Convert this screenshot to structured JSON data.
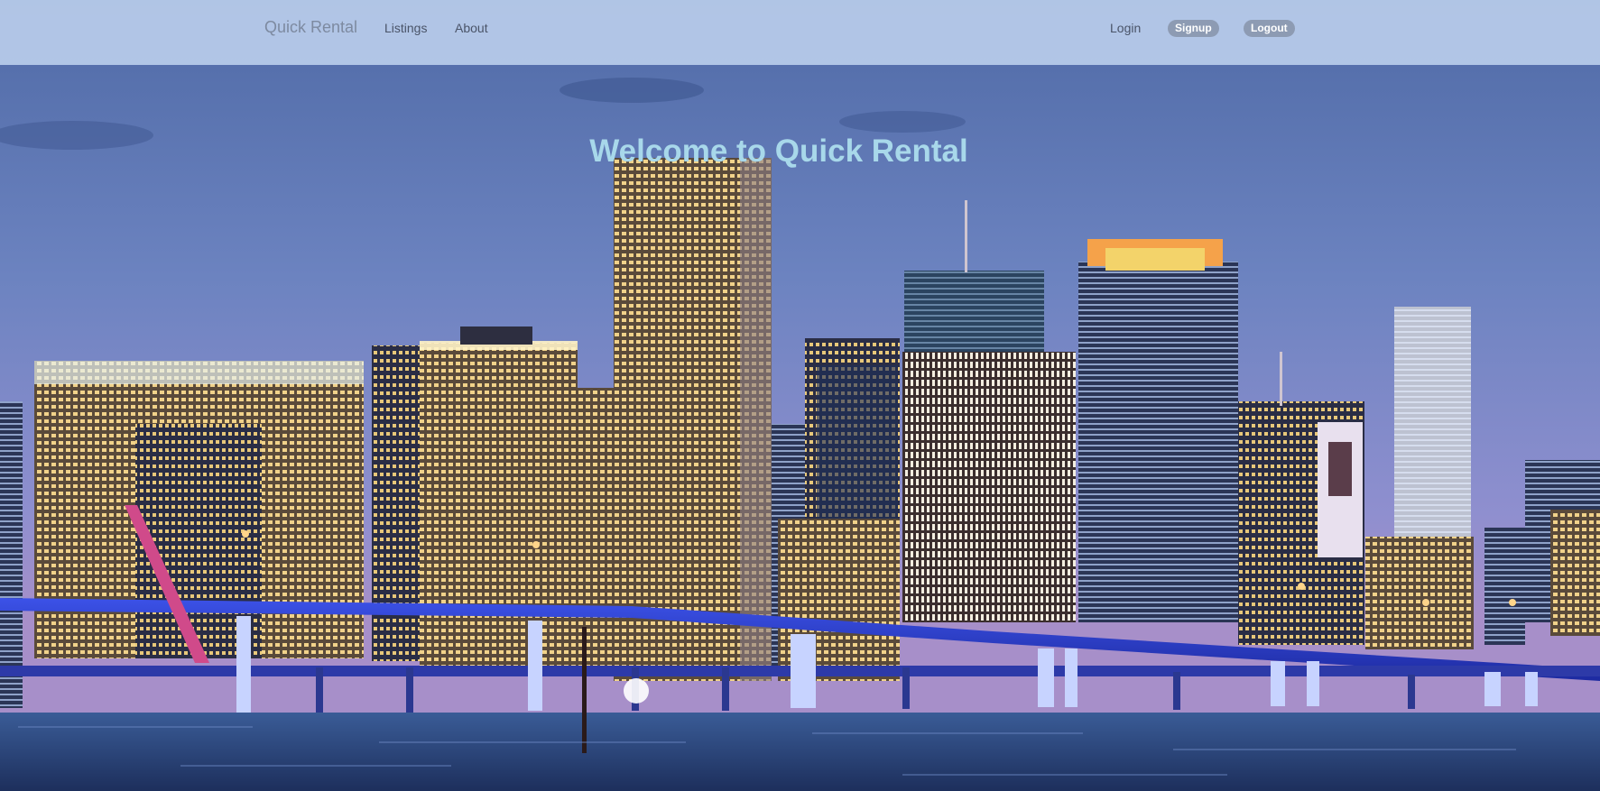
{
  "navbar": {
    "brand": "Quick Rental",
    "links": {
      "listings": "Listings",
      "about": "About"
    },
    "auth": {
      "login": "Login",
      "signup": "Signup",
      "logout": "Logout"
    }
  },
  "hero": {
    "title": "Welcome to Quick Rental",
    "background_image": "city-skyline-night-photo"
  },
  "colors": {
    "navbar_bg": "#bed2ee",
    "title_text": "#a8d8ea",
    "pill_bg": "#8d9bb3"
  }
}
